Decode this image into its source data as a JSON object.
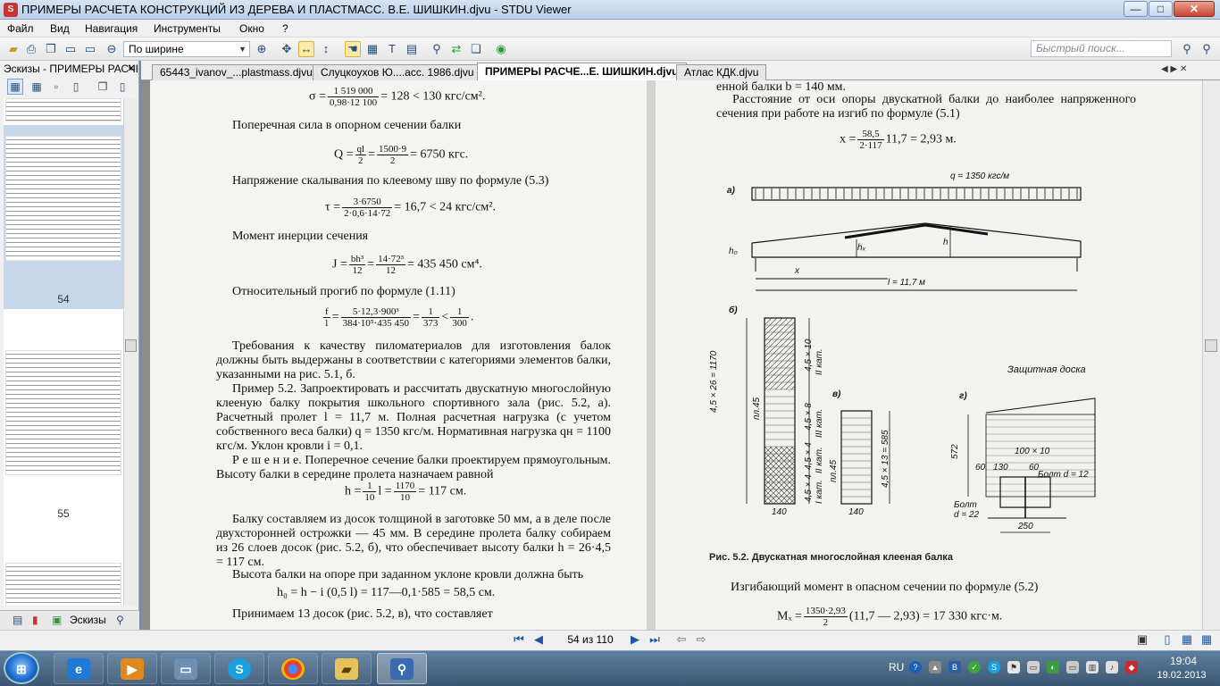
{
  "window": {
    "title": "ПРИМЕРЫ РАСЧЕТА КОНСТРУКЦИЙ ИЗ ДЕРЕВА И ПЛАСТМАСС. В.Е. ШИШКИН.djvu - STDU Viewer",
    "minimize": "—",
    "maximize": "□",
    "close": "✕"
  },
  "menu": [
    "Файл",
    "Вид",
    "Навигация",
    "Инструменты",
    "Окно",
    "?"
  ],
  "toolbar": {
    "zoom_value": "По ширине",
    "search_placeholder": "Быстрый поиск..."
  },
  "left_panel": {
    "title": "Эскизы - ПРИМЕРЫ РАСЧЕ",
    "close": "✕",
    "thumb_labels": [
      "54",
      "55"
    ],
    "bottom_tab": "Эскизы"
  },
  "tabs": [
    "65443_ivanov_...plastmass.djvu",
    "Слуцкоухов Ю....асс. 1986.djvu",
    "ПРИМЕРЫ РАСЧЕ...Е. ШИШКИН.djvu",
    "Атлас КДК.djvu"
  ],
  "left_page": {
    "sigma_lhs": "σ =",
    "sigma_num": "1 519 000",
    "sigma_den": "0,98·12 100",
    "sigma_rhs": "= 128 < 130  кгс/см².",
    "p_shear": "Поперечная сила в опорном сечении балки",
    "q_lhs": "Q =",
    "q_num1": "ql",
    "q_den1": "2",
    "q_eq": "=",
    "q_num2": "1500·9",
    "q_den2": "2",
    "q_rhs": "= 6750  кгс.",
    "p_tau": "Напряжение скалывания по клеевому шву по формуле (5.3)",
    "tau_lhs": "τ =",
    "tau_num": "3·6750",
    "tau_den": "2·0,6·14·72",
    "tau_rhs": "= 16,7 < 24  кгс/см².",
    "p_inertia": "Момент инерции сечения",
    "j_lhs": "J =",
    "j_num1": "bh³",
    "j_den1": "12",
    "j_eq": "=",
    "j_num2": "14·72³",
    "j_den2": "12",
    "j_rhs": "= 435 450  см⁴.",
    "p_deflection": "Относительный прогиб по формуле (1.11)",
    "f_num0": "f",
    "f_den0": "l",
    "f_eq1": "=",
    "f_num1": "5·12,3·900³",
    "f_den1": "384·10⁵·435 450",
    "f_eq2": "=",
    "f_num2": "1",
    "f_den2": "373",
    "f_lt": "<",
    "f_num3": "1",
    "f_den3": "300",
    "f_end": ".",
    "p_requirements": "Требования к качеству пиломатериалов для изготовления балок должны быть выдержаны в соответствии с категориями элементов балки, указанными на рис. 5.1, б.",
    "p_example": "Пример 5.2. Запроектировать и рассчитать двускатную многослойную клееную балку покрытия школьного спортивного зала (рис. 5.2, а). Расчетный пролет l = 11,7 м. Полная расчетная нагрузка (с учетом собственного веса балки) q = 1350 кгс/м. Нормативная нагрузка qн = 1100 кгс/м. Уклон кровли i = 0,1.",
    "p_solution": "Р е ш е н и е. Поперечное сечение балки проектируем прямоугольным. Высоту балки в середине пролета назначаем равной",
    "h_lhs": "h =",
    "h_num1": "1",
    "h_den1": "10",
    "h_mid": "l =",
    "h_num2": "1170",
    "h_den2": "10",
    "h_rhs": "= 117  см.",
    "p_boards": "Балку составляем из досок толщиной в заготовке 50 мм, а в деле после двухсторонней острожки — 45 мм. В середине пролета балку собираем из 26 слоев досок (рис. 5.2, б), что обеспечивает высоту балки h = 26·4,5 = 117 см.",
    "p_support": "Высота балки на опоре при заданном уклоне кровли должна быть",
    "h0_formula": "h₀ = h − i (0,5 l) = 117—0,1·585 = 58,5 см.",
    "p_accept": "Принимаем 13 досок (рис. 5.2, в), что составляет"
  },
  "right_page": {
    "top_line": "енной балки b = 140 мм.",
    "p_distance": "Расстояние от оси опоры двускатной балки до наиболее напряженного сечения при работе на изгиб по формуле (5.1)",
    "x_lhs": "x =",
    "x_num": "58,5",
    "x_den": "2·117",
    "x_rhs": "11,7 = 2,93  м.",
    "fig_label_a": "а)",
    "fig_load": "q = 1350 кгс/м",
    "fig_h0": "h₀",
    "fig_hx": "hₓ",
    "fig_h": "h",
    "fig_x": "x",
    "fig_span": "l = 11,7 м",
    "fig_label_b": "б)",
    "fig_label_v": "в)",
    "fig_label_g": "г)",
    "fig_dim_total": "4,5 × 26 = 1170",
    "fig_dim_45x10": "4,5 × 10",
    "fig_cat2": "II кат.",
    "fig_dim_45x8": "4,5 × 8",
    "fig_cat3": "III кат.",
    "fig_dim_45x4a": "4,5 × 4",
    "fig_cat2b": "II кат.",
    "fig_dim_45x4b": "4,5 × 4",
    "fig_cat1": "I кат.",
    "fig_dim_140a": "140",
    "fig_dim_140b": "140",
    "fig_dim_13": "4,5 × 13 = 585",
    "fig_board": "Защитная доска",
    "fig_572": "572",
    "fig_100x10": "100 × 10",
    "fig_60a": "60",
    "fig_130": "130",
    "fig_60b": "60",
    "fig_bolt12": "Болт d = 12",
    "fig_bolt22": "Болт d = 22",
    "fig_250": "250",
    "fig_pl45a": "пл.45",
    "fig_pl45b": "пл.45",
    "caption": "Рис. 5.2. Двускатная многослойная клееная балка",
    "p_moment": "Изгибающий момент в опасном сечении по формуле (5.2)",
    "m_lhs": "Mₓ =",
    "m_num": "1350·2,93",
    "m_den": "2",
    "m_rhs": "(11,7 — 2,93) = 17 330  кгс·м."
  },
  "status": {
    "page_indicator": "54 из 110"
  },
  "taskbar": {
    "lang": "RU",
    "time": "19:04",
    "date": "19.02.2013"
  }
}
